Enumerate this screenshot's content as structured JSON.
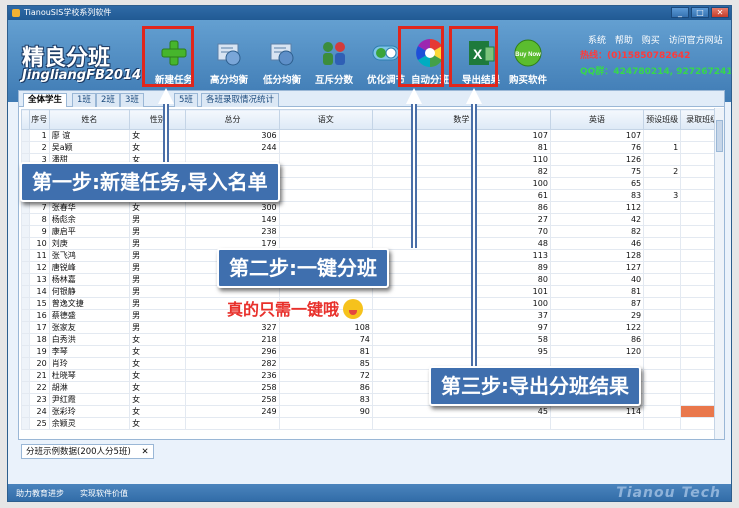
{
  "window": {
    "title": "TianouSIS学校系列软件",
    "buttons": [
      "_",
      "□",
      "✕"
    ]
  },
  "logo": {
    "main": "精良分班",
    "sub": "JingliangFB2014"
  },
  "toolbar": [
    {
      "label": "新建任务",
      "icon": "plus-icon"
    },
    {
      "label": "高分均衡",
      "icon": "balance-icon"
    },
    {
      "label": "低分均衡",
      "icon": "balance-low-icon"
    },
    {
      "label": "互斥分数",
      "icon": "people-exchange-icon"
    },
    {
      "label": "优化调节",
      "icon": "adjust-icon"
    },
    {
      "label": "自动分班",
      "icon": "color-wheel-icon"
    },
    {
      "label": "导出结果",
      "icon": "excel-export-icon"
    },
    {
      "label": "购买软件",
      "icon": "buy-now-icon"
    }
  ],
  "buy_icon_text": "Buy Now",
  "top_links": [
    "系统",
    "帮助",
    "购买",
    "访问官方网站"
  ],
  "hotline": "热线：(0)15850782642",
  "qq": "QQ群：424780214, 927267241",
  "tabs": [
    "全体学生",
    "1班",
    "2班",
    "3班",
    "5班",
    "各班录取情况统计"
  ],
  "columns": [
    "序号",
    "姓名",
    "性别",
    "总分",
    "语文",
    "数学",
    "英语",
    "预设班级",
    "录取班级"
  ],
  "rows": [
    {
      "n": "1",
      "name": "廖 谊",
      "sex": "女",
      "total": "306",
      "chinese": "",
      "math": "107",
      "english": "107",
      "preset": "",
      "assigned": ""
    },
    {
      "n": "2",
      "name": "吴a颖",
      "sex": "女",
      "total": "244",
      "chinese": "",
      "math": "81",
      "english": "76",
      "preset": "1",
      "assigned": ""
    },
    {
      "n": "3",
      "name": "潘甜",
      "sex": "女",
      "total": "",
      "chinese": "",
      "math": "110",
      "english": "126",
      "preset": "",
      "assigned": ""
    },
    {
      "n": "4",
      "name": "",
      "sex": "",
      "total": "",
      "chinese": "",
      "math": "82",
      "english": "75",
      "preset": "2",
      "assigned": ""
    },
    {
      "n": "5",
      "name": "",
      "sex": "",
      "total": "",
      "chinese": "",
      "math": "100",
      "english": "65",
      "preset": "",
      "assigned": ""
    },
    {
      "n": "6",
      "name": "",
      "sex": "",
      "total": "",
      "chinese": "",
      "math": "61",
      "english": "83",
      "preset": "3",
      "assigned": ""
    },
    {
      "n": "7",
      "name": "张春华",
      "sex": "女",
      "total": "300",
      "chinese": "",
      "math": "86",
      "english": "112",
      "preset": "",
      "assigned": ""
    },
    {
      "n": "8",
      "name": "杨彪余",
      "sex": "男",
      "total": "149",
      "chinese": "",
      "math": "27",
      "english": "42",
      "preset": "",
      "assigned": ""
    },
    {
      "n": "9",
      "name": "康启平",
      "sex": "男",
      "total": "238",
      "chinese": "",
      "math": "70",
      "english": "82",
      "preset": "",
      "assigned": ""
    },
    {
      "n": "10",
      "name": "刘庚",
      "sex": "男",
      "total": "179",
      "chinese": "",
      "math": "48",
      "english": "46",
      "preset": "",
      "assigned": ""
    },
    {
      "n": "11",
      "name": "张飞鸿",
      "sex": "男",
      "total": "",
      "chinese": "",
      "math": "113",
      "english": "128",
      "preset": "",
      "assigned": ""
    },
    {
      "n": "12",
      "name": "唐锐峰",
      "sex": "男",
      "total": "",
      "chinese": "",
      "math": "89",
      "english": "127",
      "preset": "",
      "assigned": ""
    },
    {
      "n": "13",
      "name": "杨林嘉",
      "sex": "男",
      "total": "",
      "chinese": "",
      "math": "80",
      "english": "40",
      "preset": "",
      "assigned": ""
    },
    {
      "n": "14",
      "name": "何银静",
      "sex": "男",
      "total": "",
      "chinese": "",
      "math": "101",
      "english": "81",
      "preset": "",
      "assigned": ""
    },
    {
      "n": "15",
      "name": "曾逸文捷",
      "sex": "男",
      "total": "",
      "chinese": "",
      "math": "100",
      "english": "87",
      "preset": "",
      "assigned": ""
    },
    {
      "n": "16",
      "name": "蔡德盛",
      "sex": "男",
      "total": "",
      "chinese": "",
      "math": "37",
      "english": "29",
      "preset": "",
      "assigned": ""
    },
    {
      "n": "17",
      "name": "张家友",
      "sex": "男",
      "total": "327",
      "chinese": "108",
      "math": "97",
      "english": "122",
      "preset": "",
      "assigned": ""
    },
    {
      "n": "18",
      "name": "白秀洪",
      "sex": "女",
      "total": "218",
      "chinese": "74",
      "math": "58",
      "english": "86",
      "preset": "",
      "assigned": ""
    },
    {
      "n": "19",
      "name": "李琴",
      "sex": "女",
      "total": "296",
      "chinese": "81",
      "math": "95",
      "english": "120",
      "preset": "",
      "assigned": ""
    },
    {
      "n": "20",
      "name": "肖玲",
      "sex": "女",
      "total": "282",
      "chinese": "85",
      "math": "",
      "english": "",
      "preset": "",
      "assigned": ""
    },
    {
      "n": "21",
      "name": "杜晓琴",
      "sex": "女",
      "total": "236",
      "chinese": "72",
      "math": "",
      "english": "",
      "preset": "",
      "assigned": ""
    },
    {
      "n": "22",
      "name": "胡淋",
      "sex": "女",
      "total": "258",
      "chinese": "86",
      "math": "",
      "english": "",
      "preset": "",
      "assigned": ""
    },
    {
      "n": "23",
      "name": "尹红霞",
      "sex": "女",
      "total": "258",
      "chinese": "83",
      "math": "",
      "english": "",
      "preset": "",
      "assigned": ""
    },
    {
      "n": "24",
      "name": "张彩玲",
      "sex": "女",
      "total": "249",
      "chinese": "90",
      "math": "45",
      "english": "114",
      "preset": "",
      "assigned": ""
    },
    {
      "n": "25",
      "name": "余颖灵",
      "sex": "女",
      "total": "",
      "chinese": "",
      "math": "",
      "english": "",
      "preset": "",
      "assigned": ""
    }
  ],
  "bottom_tab": {
    "label": "分班示例数据(200人分5班)",
    "close": "✕"
  },
  "status": {
    "left": "助力教育进步　　实现软件价值",
    "right": "Tianou Tech"
  },
  "callouts": {
    "step1": "第一步:新建任务,导入名单",
    "step2": "第二步:一键分班",
    "step3": "第三步:导出分班结果",
    "note": "真的只需一键哦"
  },
  "colors": {
    "accent": "#3f7bb4",
    "highlight": "#e0261c",
    "callout": "#3f6fae",
    "assigned_marker": "#e9774b"
  }
}
